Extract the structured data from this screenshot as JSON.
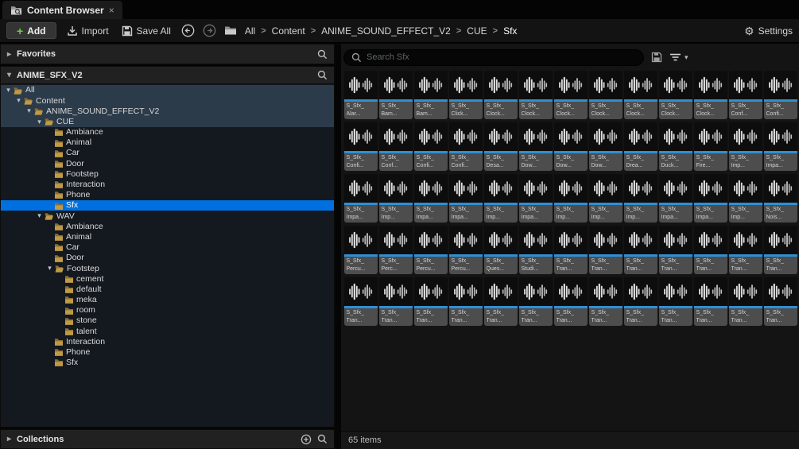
{
  "tab": {
    "title": "Content Browser",
    "close_glyph": "×"
  },
  "toolbar": {
    "add_label": "Add",
    "import_label": "Import",
    "save_all_label": "Save All",
    "settings_label": "Settings",
    "breadcrumb": [
      "All",
      "Content",
      "ANIME_SOUND_EFFECT_V2",
      "CUE",
      "Sfx"
    ]
  },
  "left": {
    "favorites_label": "Favorites",
    "source_label": "ANIME_SFX_V2",
    "collections_label": "Collections",
    "tree": [
      {
        "label": "All",
        "level": 0,
        "state": "open",
        "highlight": true
      },
      {
        "label": "Content",
        "level": 1,
        "state": "open",
        "highlight": true
      },
      {
        "label": "ANIME_SOUND_EFFECT_V2",
        "level": 2,
        "state": "open",
        "highlight": true
      },
      {
        "label": "CUE",
        "level": 3,
        "state": "open",
        "highlight": true
      },
      {
        "label": "Ambiance",
        "level": 4,
        "state": "closed"
      },
      {
        "label": "Animal",
        "level": 4,
        "state": "closed"
      },
      {
        "label": "Car",
        "level": 4,
        "state": "closed"
      },
      {
        "label": "Door",
        "level": 4,
        "state": "closed"
      },
      {
        "label": "Footstep",
        "level": 4,
        "state": "closed"
      },
      {
        "label": "Interaction",
        "level": 4,
        "state": "closed"
      },
      {
        "label": "Phone",
        "level": 4,
        "state": "closed"
      },
      {
        "label": "Sfx",
        "level": 4,
        "state": "closed",
        "selected": true
      },
      {
        "label": "WAV",
        "level": 3,
        "state": "open"
      },
      {
        "label": "Ambiance",
        "level": 4,
        "state": "closed"
      },
      {
        "label": "Animal",
        "level": 4,
        "state": "closed"
      },
      {
        "label": "Car",
        "level": 4,
        "state": "closed"
      },
      {
        "label": "Door",
        "level": 4,
        "state": "closed"
      },
      {
        "label": "Footstep",
        "level": 4,
        "state": "open"
      },
      {
        "label": "cement",
        "level": 5,
        "state": "closed"
      },
      {
        "label": "default",
        "level": 5,
        "state": "closed"
      },
      {
        "label": "meka",
        "level": 5,
        "state": "closed"
      },
      {
        "label": "room",
        "level": 5,
        "state": "closed"
      },
      {
        "label": "stone",
        "level": 5,
        "state": "closed"
      },
      {
        "label": "talent",
        "level": 5,
        "state": "closed"
      },
      {
        "label": "Interaction",
        "level": 4,
        "state": "closed"
      },
      {
        "label": "Phone",
        "level": 4,
        "state": "closed"
      },
      {
        "label": "Sfx",
        "level": 4,
        "state": "closed"
      }
    ]
  },
  "right": {
    "search_placeholder": "Search Sfx",
    "items_count": "65 items",
    "name_prefix": "S_Sfx_",
    "items": [
      "Alar...",
      "Bam...",
      "Bam...",
      "Click...",
      "Clock...",
      "Clock...",
      "Clock...",
      "Clock...",
      "Clock...",
      "Clock...",
      "Clock...",
      "Conf...",
      "Confi...",
      "Confi...",
      "Conf...",
      "Confi...",
      "Confi...",
      "Desa...",
      "Dow...",
      "Dow...",
      "Dow...",
      "Drea...",
      "Duck...",
      "Fire...",
      "Imp...",
      "Impa...",
      "Impa...",
      "Imp...",
      "Impa...",
      "Impa...",
      "Imp...",
      "Impa...",
      "Imp...",
      "Imp...",
      "Imp...",
      "Impa...",
      "Impa...",
      "Imp...",
      "Nois...",
      "Percu...",
      "Perc...",
      "Percu...",
      "Percu...",
      "Ques...",
      "Studi...",
      "Tran...",
      "Tran...",
      "Tran...",
      "Tran...",
      "Tran...",
      "Tran...",
      "Tran...",
      "Tran...",
      "Tran...",
      "Tran...",
      "Tran...",
      "Tran...",
      "Tran...",
      "Tran...",
      "Tran...",
      "Tran...",
      "Tran...",
      "Tran...",
      "Tran...",
      "Tran..."
    ]
  },
  "icons": {
    "tab_icon": "folder-with-magnifier",
    "import_icon": "arrow-into-tray",
    "save_icon": "floppy-disk",
    "back_icon": "circled-arrow-left",
    "forward_icon": "circled-arrow-right",
    "breadcrumb_folder_icon": "folder",
    "settings_icon": "gear",
    "search_icon": "magnifier",
    "filter_icon": "funnel-lines",
    "add_collection_icon": "circled-plus",
    "asset_icon": "sound-waveform"
  },
  "colors": {
    "selection_blue": "#0070e0",
    "ancestor_highlight": "#2c3b4a",
    "sound_type_blue": "#2e8fd4",
    "folder_tan": "#bf9b45",
    "add_plus_green": "#6bd23b"
  }
}
